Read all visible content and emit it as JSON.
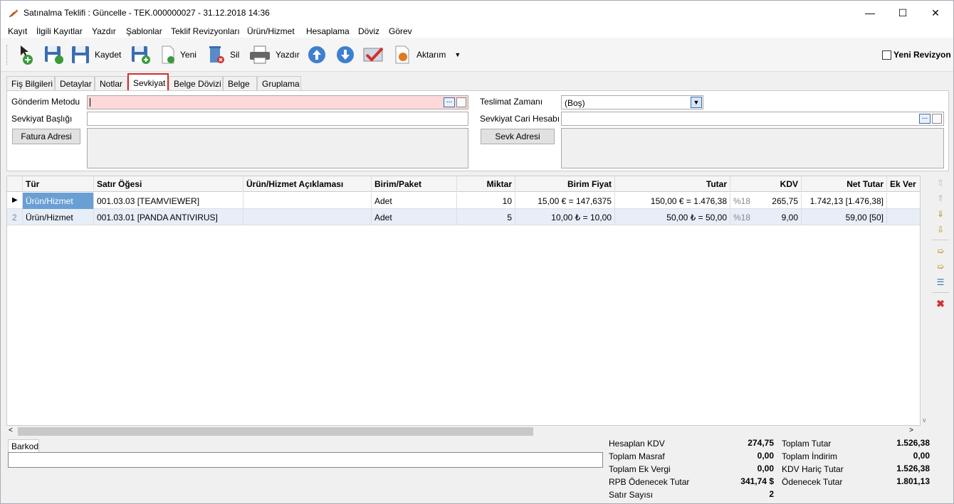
{
  "window": {
    "title": "Satınalma Teklifi : Güncelle - TEK.000000027 - 31.12.2018 14:36",
    "minimize_glyph": "—",
    "maximize_glyph": "☐",
    "close_glyph": "✕"
  },
  "menu": [
    "Kayıt",
    "İlgili Kayıtlar",
    "Yazdır",
    "Şablonlar",
    "Teklif Revizyonları",
    "Ürün/Hizmet",
    "Hesaplama",
    "Döviz",
    "Görev"
  ],
  "toolbar": {
    "save_label": "Kaydet",
    "new_label": "Yeni",
    "delete_label": "Sil",
    "print_label": "Yazdır",
    "transfer_label": "Aktarım",
    "new_revision_label": "Yeni Revizyon"
  },
  "tabs": [
    "Fiş Bilgileri",
    "Detaylar",
    "Notlar",
    "Sevkiyat",
    "Belge Dövizi",
    "Belge",
    "Gruplama"
  ],
  "shipping": {
    "method_label": "Gönderim Metodu",
    "method_value": "",
    "title_label": "Sevkiyat Başlığı",
    "title_value": "",
    "invoice_address_button": "Fatura Adresi",
    "delivery_time_label": "Teslimat Zamanı",
    "delivery_time_value": "(Boş)",
    "shipping_account_label": "Sevkiyat Cari Hesabı",
    "shipping_account_value": "",
    "shipping_address_button": "Sevk Adresi"
  },
  "grid": {
    "columns": [
      "Tür",
      "Satır Öğesi",
      "Ürün/Hizmet Açıklaması",
      "Birim/Paket",
      "Miktar",
      "Birim Fiyat",
      "Tutar",
      "KDV",
      "Net Tutar",
      "Ek Ver"
    ],
    "rows": [
      {
        "indicator": "▶",
        "type": "Ürün/Hizmet",
        "item": "001.03.03 [TEAMVIEWER]",
        "desc": "",
        "unit": "Adet",
        "qty": "10",
        "unit_price": "15,00 € = 147,6375",
        "amount": "150,00 € = 1.476,38",
        "vat_rate": "%18",
        "vat": "265,75",
        "net": "1.742,13 [1.476,38]",
        "extra": ""
      },
      {
        "indicator": "2",
        "type": "Ürün/Hizmet",
        "item": "001.03.01 [PANDA ANTIVIRUS]",
        "desc": "",
        "unit": "Adet",
        "qty": "5",
        "unit_price": "10,00 ₺ = 10,00",
        "amount": "50,00 ₺ = 50,00",
        "vat_rate": "%18",
        "vat": "9,00",
        "net": "59,00 [50]",
        "extra": ""
      }
    ]
  },
  "barcode": {
    "tab_label": "Barkod",
    "value": ""
  },
  "summary": {
    "left": [
      {
        "label": "Hesaplan KDV",
        "value": "274,75"
      },
      {
        "label": "Toplam Masraf",
        "value": "0,00"
      },
      {
        "label": "Toplam Ek Vergi",
        "value": "0,00"
      },
      {
        "label": "RPB Ödenecek Tutar",
        "value": "341,74 $"
      },
      {
        "label": "Satır Sayısı",
        "value": "2"
      }
    ],
    "right": [
      {
        "label": "Toplam Tutar",
        "value": "1.526,38"
      },
      {
        "label": "Toplam İndirim",
        "value": "0,00"
      },
      {
        "label": "KDV Hariç Tutar",
        "value": "1.526,38"
      },
      {
        "label": "Ödenecek Tutar",
        "value": "1.801,13"
      }
    ]
  },
  "colors": {
    "accent": "#d32f2f",
    "selected_cell": "#6a9fd4",
    "pink_field": "#fdd9d9"
  }
}
